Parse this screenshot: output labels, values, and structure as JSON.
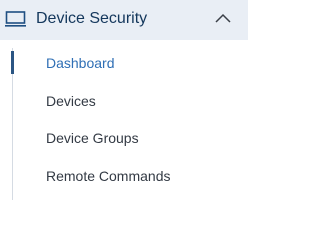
{
  "nav": {
    "section_title": "Device Security",
    "section_icon": "monitor-icon",
    "expand_icon": "chevron-up-icon",
    "active_color": "#2f6fb5",
    "header_background": "#e9eef5",
    "items": [
      {
        "label": "Dashboard",
        "active": true
      },
      {
        "label": "Devices",
        "active": false
      },
      {
        "label": "Device Groups",
        "active": false
      },
      {
        "label": "Remote Commands",
        "active": false
      }
    ]
  }
}
